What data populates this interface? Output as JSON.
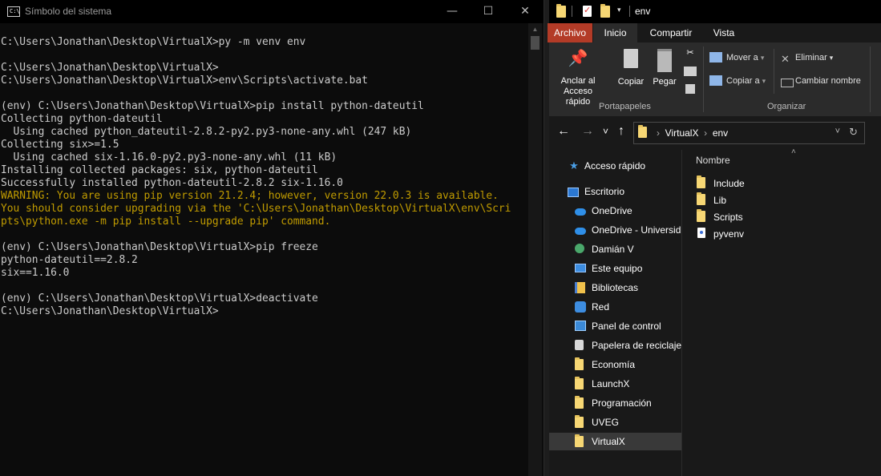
{
  "cmd": {
    "title": "Símbolo del sistema",
    "icon_text": "C:\\",
    "controls": {
      "minimize": "—",
      "maximize": "☐",
      "close": "✕"
    },
    "lines": [
      {
        "text": "",
        "style": "normal"
      },
      {
        "text": "C:\\Users\\Jonathan\\Desktop\\VirtualX>py -m venv env",
        "style": "normal"
      },
      {
        "text": "",
        "style": "normal"
      },
      {
        "text": "C:\\Users\\Jonathan\\Desktop\\VirtualX>",
        "style": "normal"
      },
      {
        "text": "C:\\Users\\Jonathan\\Desktop\\VirtualX>env\\Scripts\\activate.bat",
        "style": "normal"
      },
      {
        "text": "",
        "style": "normal"
      },
      {
        "text": "(env) C:\\Users\\Jonathan\\Desktop\\VirtualX>pip install python-dateutil",
        "style": "normal"
      },
      {
        "text": "Collecting python-dateutil",
        "style": "normal"
      },
      {
        "text": "  Using cached python_dateutil-2.8.2-py2.py3-none-any.whl (247 kB)",
        "style": "normal"
      },
      {
        "text": "Collecting six>=1.5",
        "style": "normal"
      },
      {
        "text": "  Using cached six-1.16.0-py2.py3-none-any.whl (11 kB)",
        "style": "normal"
      },
      {
        "text": "Installing collected packages: six, python-dateutil",
        "style": "normal"
      },
      {
        "text": "Successfully installed python-dateutil-2.8.2 six-1.16.0",
        "style": "normal"
      },
      {
        "text": "WARNING: You are using pip version 21.2.4; however, version 22.0.3 is available.",
        "style": "warn"
      },
      {
        "text": "You should consider upgrading via the 'C:\\Users\\Jonathan\\Desktop\\VirtualX\\env\\Scri",
        "style": "warn"
      },
      {
        "text": "pts\\python.exe -m pip install --upgrade pip' command.",
        "style": "warn"
      },
      {
        "text": "",
        "style": "normal"
      },
      {
        "text": "(env) C:\\Users\\Jonathan\\Desktop\\VirtualX>pip freeze",
        "style": "normal"
      },
      {
        "text": "python-dateutil==2.8.2",
        "style": "normal"
      },
      {
        "text": "six==1.16.0",
        "style": "normal"
      },
      {
        "text": "",
        "style": "normal"
      },
      {
        "text": "(env) C:\\Users\\Jonathan\\Desktop\\VirtualX>deactivate",
        "style": "normal"
      },
      {
        "text": "C:\\Users\\Jonathan\\Desktop\\VirtualX>",
        "style": "normal"
      }
    ]
  },
  "explorer": {
    "window_path": "env",
    "tabs": {
      "file": "Archivo",
      "home": "Inicio",
      "share": "Compartir",
      "view": "Vista"
    },
    "ribbon": {
      "pin": "Anclar al\nAcceso rápido",
      "copy": "Copiar",
      "paste": "Pegar",
      "move_to": "Mover a",
      "copy_to": "Copiar a",
      "delete": "Eliminar",
      "rename": "Cambiar nombre",
      "group_clipboard": "Portapapeles",
      "group_organize": "Organizar"
    },
    "address": {
      "crumb1": "VirtualX",
      "crumb2": "env",
      "sep": "›"
    },
    "nav_icons": {
      "back": "←",
      "forward": "→",
      "recent": "˅",
      "up": "↑",
      "refresh": "↻"
    },
    "sidebar": [
      {
        "label": "Acceso rápido",
        "icon": "star-icon"
      },
      {
        "label": "Escritorio",
        "icon": "desktop-icon"
      },
      {
        "label": "OneDrive",
        "icon": "onedrive-icon"
      },
      {
        "label": "OneDrive - Universid",
        "icon": "onedrive-icon"
      },
      {
        "label": "Damián V",
        "icon": "user-icon"
      },
      {
        "label": "Este equipo",
        "icon": "computer-icon"
      },
      {
        "label": "Bibliotecas",
        "icon": "libraries-icon"
      },
      {
        "label": "Red",
        "icon": "network-icon"
      },
      {
        "label": "Panel de control",
        "icon": "control-panel-icon"
      },
      {
        "label": "Papelera de reciclaje",
        "icon": "recycle-bin-icon"
      },
      {
        "label": "Economía",
        "icon": "folder-icon"
      },
      {
        "label": "LaunchX",
        "icon": "folder-icon"
      },
      {
        "label": "Programación",
        "icon": "folder-icon"
      },
      {
        "label": "UVEG",
        "icon": "folder-icon"
      },
      {
        "label": "VirtualX",
        "icon": "folder-icon"
      }
    ],
    "column_header": "Nombre",
    "files": [
      {
        "name": "Include",
        "icon": "folder-icon"
      },
      {
        "name": "Lib",
        "icon": "folder-icon"
      },
      {
        "name": "Scripts",
        "icon": "folder-icon"
      },
      {
        "name": "pyvenv",
        "icon": "config-file-icon"
      }
    ]
  },
  "colors": {
    "cmd_bg": "#0c0c0c",
    "cmd_text": "#cccccc",
    "warning_text": "#c19c00",
    "file_tab": "#b33b27",
    "folder": "#f7d774"
  }
}
